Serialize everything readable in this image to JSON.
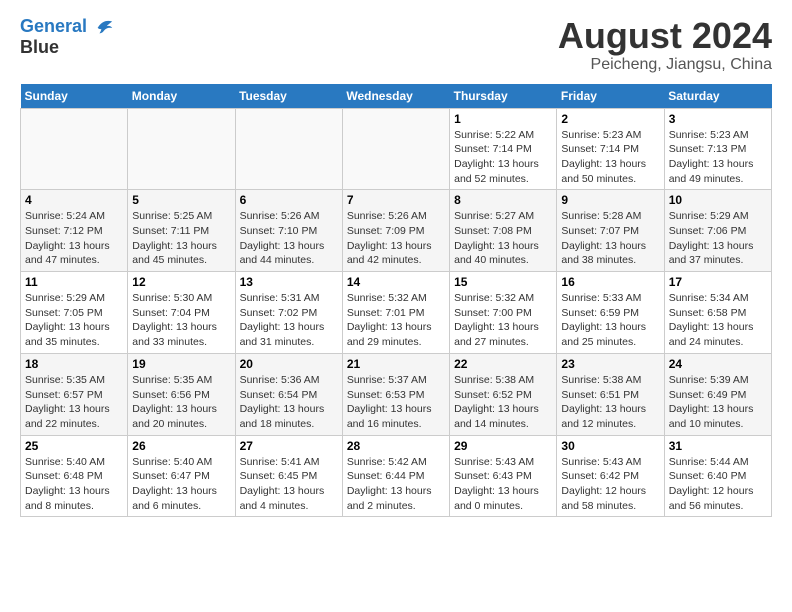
{
  "header": {
    "logo_line1": "General",
    "logo_line2": "Blue",
    "title": "August 2024",
    "subtitle": "Peicheng, Jiangsu, China"
  },
  "weekdays": [
    "Sunday",
    "Monday",
    "Tuesday",
    "Wednesday",
    "Thursday",
    "Friday",
    "Saturday"
  ],
  "weeks": [
    [
      {
        "day": "",
        "info": ""
      },
      {
        "day": "",
        "info": ""
      },
      {
        "day": "",
        "info": ""
      },
      {
        "day": "",
        "info": ""
      },
      {
        "day": "1",
        "info": "Sunrise: 5:22 AM\nSunset: 7:14 PM\nDaylight: 13 hours\nand 52 minutes."
      },
      {
        "day": "2",
        "info": "Sunrise: 5:23 AM\nSunset: 7:14 PM\nDaylight: 13 hours\nand 50 minutes."
      },
      {
        "day": "3",
        "info": "Sunrise: 5:23 AM\nSunset: 7:13 PM\nDaylight: 13 hours\nand 49 minutes."
      }
    ],
    [
      {
        "day": "4",
        "info": "Sunrise: 5:24 AM\nSunset: 7:12 PM\nDaylight: 13 hours\nand 47 minutes."
      },
      {
        "day": "5",
        "info": "Sunrise: 5:25 AM\nSunset: 7:11 PM\nDaylight: 13 hours\nand 45 minutes."
      },
      {
        "day": "6",
        "info": "Sunrise: 5:26 AM\nSunset: 7:10 PM\nDaylight: 13 hours\nand 44 minutes."
      },
      {
        "day": "7",
        "info": "Sunrise: 5:26 AM\nSunset: 7:09 PM\nDaylight: 13 hours\nand 42 minutes."
      },
      {
        "day": "8",
        "info": "Sunrise: 5:27 AM\nSunset: 7:08 PM\nDaylight: 13 hours\nand 40 minutes."
      },
      {
        "day": "9",
        "info": "Sunrise: 5:28 AM\nSunset: 7:07 PM\nDaylight: 13 hours\nand 38 minutes."
      },
      {
        "day": "10",
        "info": "Sunrise: 5:29 AM\nSunset: 7:06 PM\nDaylight: 13 hours\nand 37 minutes."
      }
    ],
    [
      {
        "day": "11",
        "info": "Sunrise: 5:29 AM\nSunset: 7:05 PM\nDaylight: 13 hours\nand 35 minutes."
      },
      {
        "day": "12",
        "info": "Sunrise: 5:30 AM\nSunset: 7:04 PM\nDaylight: 13 hours\nand 33 minutes."
      },
      {
        "day": "13",
        "info": "Sunrise: 5:31 AM\nSunset: 7:02 PM\nDaylight: 13 hours\nand 31 minutes."
      },
      {
        "day": "14",
        "info": "Sunrise: 5:32 AM\nSunset: 7:01 PM\nDaylight: 13 hours\nand 29 minutes."
      },
      {
        "day": "15",
        "info": "Sunrise: 5:32 AM\nSunset: 7:00 PM\nDaylight: 13 hours\nand 27 minutes."
      },
      {
        "day": "16",
        "info": "Sunrise: 5:33 AM\nSunset: 6:59 PM\nDaylight: 13 hours\nand 25 minutes."
      },
      {
        "day": "17",
        "info": "Sunrise: 5:34 AM\nSunset: 6:58 PM\nDaylight: 13 hours\nand 24 minutes."
      }
    ],
    [
      {
        "day": "18",
        "info": "Sunrise: 5:35 AM\nSunset: 6:57 PM\nDaylight: 13 hours\nand 22 minutes."
      },
      {
        "day": "19",
        "info": "Sunrise: 5:35 AM\nSunset: 6:56 PM\nDaylight: 13 hours\nand 20 minutes."
      },
      {
        "day": "20",
        "info": "Sunrise: 5:36 AM\nSunset: 6:54 PM\nDaylight: 13 hours\nand 18 minutes."
      },
      {
        "day": "21",
        "info": "Sunrise: 5:37 AM\nSunset: 6:53 PM\nDaylight: 13 hours\nand 16 minutes."
      },
      {
        "day": "22",
        "info": "Sunrise: 5:38 AM\nSunset: 6:52 PM\nDaylight: 13 hours\nand 14 minutes."
      },
      {
        "day": "23",
        "info": "Sunrise: 5:38 AM\nSunset: 6:51 PM\nDaylight: 13 hours\nand 12 minutes."
      },
      {
        "day": "24",
        "info": "Sunrise: 5:39 AM\nSunset: 6:49 PM\nDaylight: 13 hours\nand 10 minutes."
      }
    ],
    [
      {
        "day": "25",
        "info": "Sunrise: 5:40 AM\nSunset: 6:48 PM\nDaylight: 13 hours\nand 8 minutes."
      },
      {
        "day": "26",
        "info": "Sunrise: 5:40 AM\nSunset: 6:47 PM\nDaylight: 13 hours\nand 6 minutes."
      },
      {
        "day": "27",
        "info": "Sunrise: 5:41 AM\nSunset: 6:45 PM\nDaylight: 13 hours\nand 4 minutes."
      },
      {
        "day": "28",
        "info": "Sunrise: 5:42 AM\nSunset: 6:44 PM\nDaylight: 13 hours\nand 2 minutes."
      },
      {
        "day": "29",
        "info": "Sunrise: 5:43 AM\nSunset: 6:43 PM\nDaylight: 13 hours\nand 0 minutes."
      },
      {
        "day": "30",
        "info": "Sunrise: 5:43 AM\nSunset: 6:42 PM\nDaylight: 12 hours\nand 58 minutes."
      },
      {
        "day": "31",
        "info": "Sunrise: 5:44 AM\nSunset: 6:40 PM\nDaylight: 12 hours\nand 56 minutes."
      }
    ]
  ]
}
